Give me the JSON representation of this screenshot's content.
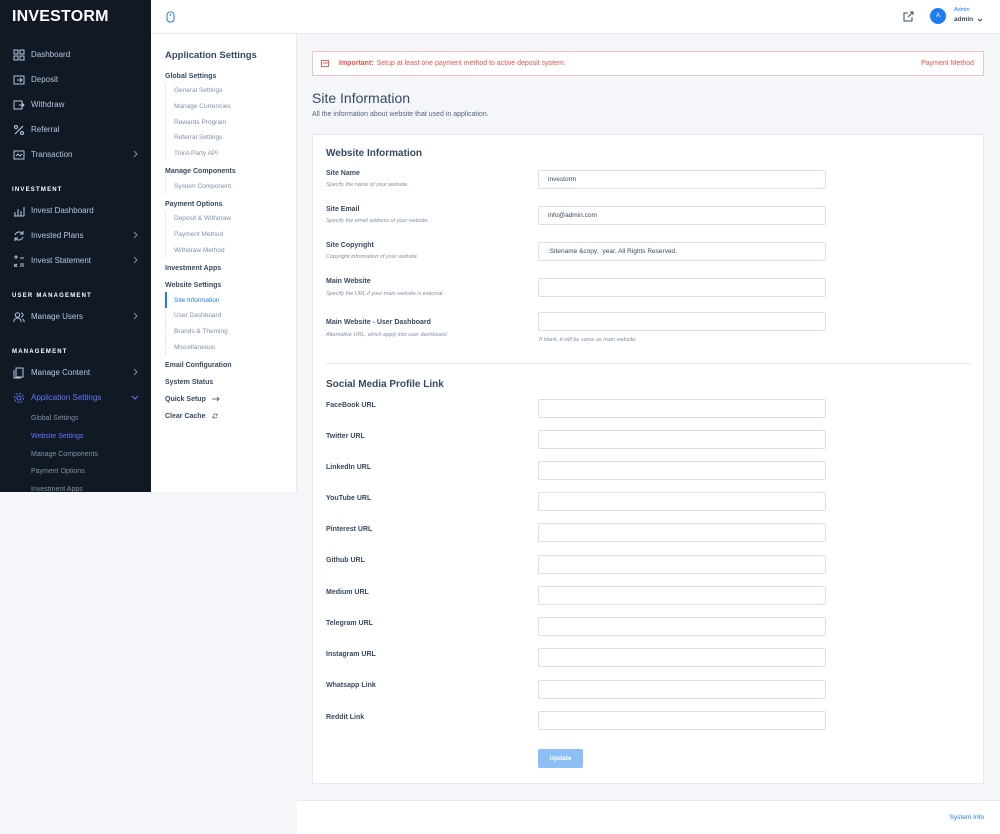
{
  "brand": {
    "name": "INVESTORM"
  },
  "sidebar": {
    "items": [
      {
        "label": "Dashboard",
        "icon": "dashboard-icon"
      },
      {
        "label": "Deposit",
        "icon": "deposit-icon"
      },
      {
        "label": "Withdraw",
        "icon": "withdraw-icon"
      },
      {
        "label": "Referral",
        "icon": "percent-icon"
      },
      {
        "label": "Transaction",
        "icon": "transaction-icon"
      }
    ],
    "investment_heading": "INVESTMENT",
    "investment_items": [
      {
        "label": "Invest Dashboard"
      },
      {
        "label": "Invested Plans"
      },
      {
        "label": "Invest Statement"
      }
    ],
    "user_heading": "USER MANAGEMENT",
    "user_items": [
      {
        "label": "Manage Users"
      }
    ],
    "management_heading": "MANAGEMENT",
    "management_items": [
      {
        "label": "Manage Content"
      },
      {
        "label": "Application Settings"
      }
    ],
    "app_settings_sub": [
      {
        "label": "Global Settings"
      },
      {
        "label": "Website Settings"
      },
      {
        "label": "Manage Components"
      },
      {
        "label": "Payment Options"
      },
      {
        "label": "Investment Apps"
      }
    ]
  },
  "topbar": {
    "avatar_initial": "A",
    "user_role": "Admin",
    "user_name": "admin"
  },
  "settings_panel": {
    "title": "Application Settings",
    "global_heading": "Global Settings",
    "global_items": [
      "General Settings",
      "Manage Currencies",
      "Rewards Program",
      "Referral Settings",
      "Third-Party API"
    ],
    "components_heading": "Manage Components",
    "components_items": [
      "System Component"
    ],
    "payment_heading": "Payment Options",
    "payment_items": [
      "Deposit & Withdraw",
      "Payment Method",
      "Withdraw Method"
    ],
    "apps_heading": "Investment Apps",
    "website_heading": "Website Settings",
    "website_items": [
      "Site Information",
      "User Dashboard",
      "Brands & Theming",
      "Miscellaneous"
    ],
    "email_config": "Email Configuration",
    "system_status": "System Status",
    "quick_setup": "Quick Setup",
    "clear_cache": "Clear Cache"
  },
  "alert": {
    "important": "Important:",
    "message": "Setup at least one payment method to active deposit system.",
    "link": "Payment Method"
  },
  "page": {
    "title": "Site Information",
    "subtitle": "All the information about website that used in application."
  },
  "form": {
    "section1_title": "Website Information",
    "site_name": {
      "label": "Site Name",
      "hint": "Specify the name of your website.",
      "value": "investorm"
    },
    "site_email": {
      "label": "Site Email",
      "hint": "Specify the email address of your website.",
      "value": "info@admin.com"
    },
    "site_copyright": {
      "label": "Site Copyright",
      "hint": "Copyright information of your website.",
      "value": ":Sitename &copy; :year. All Rights Reserved."
    },
    "main_website": {
      "label": "Main Website",
      "hint": "Specify the URL if your main website is external.",
      "value": ""
    },
    "main_website_dashboard": {
      "label": "Main Website - User Dashboard",
      "hint": "Alternative URL, which apply into user dashboard.",
      "value": "",
      "note": "If blank, it will be same as main website."
    },
    "section2_title": "Social Media Profile Link",
    "social": [
      {
        "label": "FaceBook URL",
        "value": ""
      },
      {
        "label": "Twitter URL",
        "value": ""
      },
      {
        "label": "LinkedIn URL",
        "value": ""
      },
      {
        "label": "YouTube URL",
        "value": ""
      },
      {
        "label": "Pinterest URL",
        "value": ""
      },
      {
        "label": "Github URL",
        "value": ""
      },
      {
        "label": "Medium URL",
        "value": ""
      },
      {
        "label": "Telegram URL",
        "value": ""
      },
      {
        "label": "Instagram URL",
        "value": ""
      },
      {
        "label": "Whatsapp Link",
        "value": ""
      },
      {
        "label": "Reddit Link",
        "value": ""
      }
    ],
    "update_button": "Update"
  },
  "footer": {
    "link": "System Info"
  },
  "colors": {
    "sidebar_bg": "#101924",
    "accent": "#1d7cf2",
    "danger": "#e85347",
    "button_disabled": "#8bbff5"
  }
}
